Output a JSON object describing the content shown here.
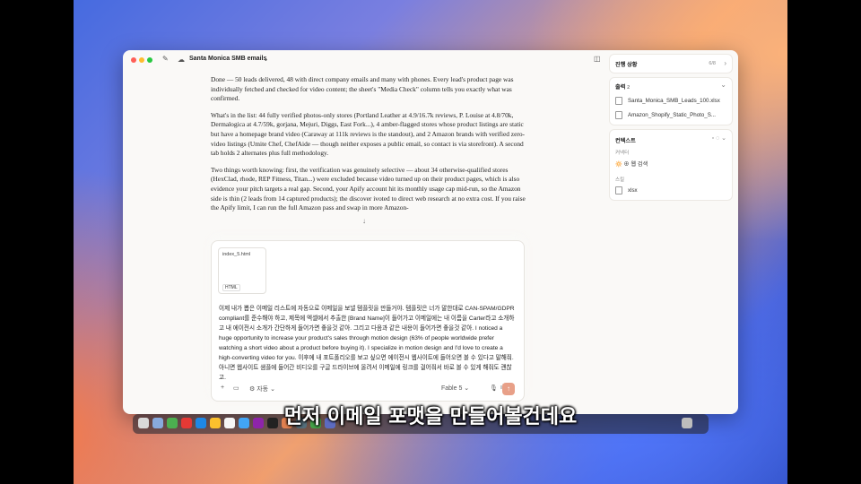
{
  "window": {
    "title": "Santa Monica SMB emails"
  },
  "main": {
    "paragraphs": [
      "Done — 50 leads delivered, 48 with direct company emails and many with phones. Every lead's product page was individually fetched and checked for video content; the sheet's \"Media Check\" column tells you exactly what was confirmed.",
      "What's in the list: 44 fully verified photos-only stores (Portland Leather at 4.9/16.7k reviews, P. Louise at 4.8/70k, Dermalogica at 4.7/59k, gorjana, Mejuri, Diggs, East Fork...), 4 amber-flagged stores whose product listings are static but have a homepage brand video (Caraway at 111k reviews is the standout), and 2 Amazon brands with verified zero-video listings (Umite Chef, ChefAide — though neither exposes a public email, so contact is via storefront). A second tab holds 2 alternates plus full methodology.",
      "Two things worth knowing: first, the verification was genuinely selective — about 34 otherwise-qualified stores (HexClad, rhode, REP Fitness, Titan...) were excluded because video turned up on their product pages, which is also evidence your pitch targets a real gap. Second, your Apify account hit its monthly usage cap mid-run, so the Amazon side is thin (2 leads from 14 captured products); the discover    ivoted to direct web research at no extra cost. If you raise the Apify limit, I can run the full Amazon pass and swap in more Amazon-"
    ]
  },
  "composer": {
    "attachment_name": "index_5.html",
    "attachment_type": "HTML",
    "text": "이제 내가 뽑은 이메일 리스트에 자동으로 이메일을 보낼 템플릿을 만들거야. 템플릿은 너가 말한대로 CAN-SPAM/GDPR compliant를 준수해야 하고, 제목에 엑셀에서 추출한 [Brand Name]이 들어가고 이메일에는 내 이름을 Carter라고 소개하고 내 에이전시 소개가 간단하게 들어가면 좋을것 같아. 그리고 다음과 같은 내용이 들어가면 좋을것 같아. I noticed a huge opportunity to increase your product's sales through motion design (63% of people worldwide prefer watching a short video about a product before buying it). I specialize in motion design and I'd love to create a high-converting video for you. 이후에 내 포트폴리오를 보고 싶으면 에이전시 웹사이트에 들어오면 볼 수 있다고 말해줘. 아니면 웹사이트 샘플에 들어간 비디오를 구글 드라이브에 올려서 이메일에 링크를 걸어줘서 바로 볼 수 있게 해줘도 괜찮고.",
    "tool_label": "자동",
    "model_label": "Fable 5"
  },
  "sidebar": {
    "progress": {
      "title": "진행 상황",
      "count": "6/8"
    },
    "output": {
      "title": "출력",
      "count": "2",
      "files": [
        "Santa_Monica_SMB_Leads_100.xlsx",
        "Amazon_Shopify_Static_Photo_S..."
      ]
    },
    "context": {
      "title": "컨텍스트",
      "section_tools": "커넥터",
      "tool_item": "웹 검색",
      "section_skills": "스킬",
      "skill_item": "xlsx"
    }
  },
  "subtitle": "먼저 이메일 포맷을 만들어볼건데요"
}
